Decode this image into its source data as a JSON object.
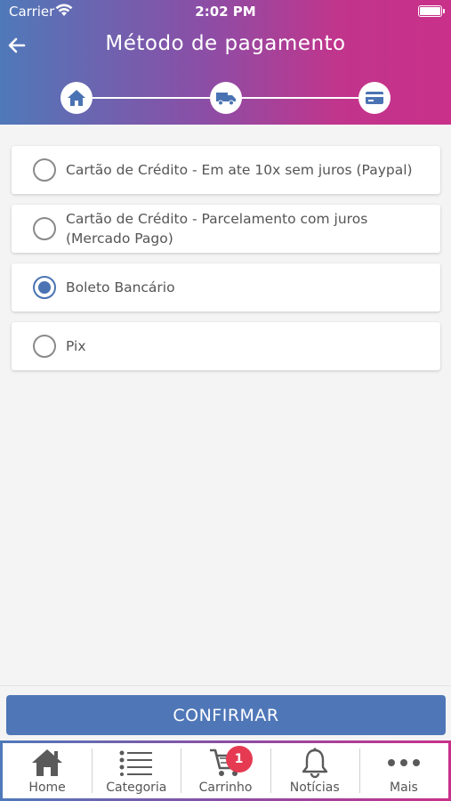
{
  "status_bar": {
    "carrier": "Carrier",
    "time": "2:02 PM"
  },
  "header": {
    "title": "Método de pagamento"
  },
  "steps": [
    {
      "icon": "home-icon",
      "state": "completed"
    },
    {
      "icon": "truck-icon",
      "state": "completed"
    },
    {
      "icon": "credit-card-icon",
      "state": "current"
    }
  ],
  "payment_options": [
    {
      "label": "Cartão de Crédito - Em ate 10x sem juros (Paypal)",
      "selected": false
    },
    {
      "label": "Cartão de Crédito - Parcelamento com juros (Mercado Pago)",
      "selected": false
    },
    {
      "label": "Boleto Bancário",
      "selected": true
    },
    {
      "label": "Pix",
      "selected": false
    }
  ],
  "confirm_label": "CONFIRMAR",
  "tabbar": {
    "items": [
      {
        "label": "Home",
        "icon": "home-icon"
      },
      {
        "label": "Categoria",
        "icon": "list-icon"
      },
      {
        "label": "Carrinho",
        "icon": "cart-icon",
        "badge": "1"
      },
      {
        "label": "Notícias",
        "icon": "bell-icon"
      },
      {
        "label": "Mais",
        "icon": "more-icon"
      }
    ]
  },
  "colors": {
    "accent": "#4f77b8",
    "gradient_start": "#4f79b9",
    "gradient_end": "#c9308a",
    "badge": "#e53a52"
  }
}
